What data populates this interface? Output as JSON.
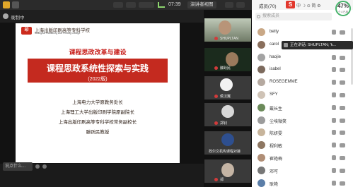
{
  "topbar": {
    "time": "07:39",
    "presenter_label": "演讲者视图"
  },
  "status": {
    "recording_text": "录制中"
  },
  "slide": {
    "org_name": "上海出版印刷高等专科学校",
    "org_sub": "Shanghai Publishing and Printing College",
    "topic": "课程思政改革与建设",
    "title": "课程思政系统性探索与实践",
    "year": "(2022版)",
    "lines": [
      "上海电力大学原教务处长",
      "上海理工大学出版印刷学院原副院长",
      "上海出版印刷高等专科学校常务副校长",
      "滕跃民教授"
    ]
  },
  "bottom": {
    "comment_placeholder": "说点什么..."
  },
  "video_tiles": [
    {
      "name": "SHUPLTAN"
    },
    {
      "name": "滕跃民"
    },
    {
      "name": "侯汉翼"
    },
    {
      "name": "郑钊"
    },
    {
      "name": "政尔文机构课程对接"
    },
    {
      "name": "郑"
    }
  ],
  "panel": {
    "title": "成员(70)",
    "sohu_text": "中 ☽ ⊙ 简 ⚙",
    "gauge_value": "47",
    "gauge_unit": "%",
    "gauge_sub": "个人已用",
    "search_placeholder": "搜索成员",
    "participants": [
      {
        "name": "betty",
        "color": "#c9a886"
      },
      {
        "name": "carol",
        "color": "#8a6f5c"
      },
      {
        "name": "haojie",
        "color": "#a3a3a3"
      },
      {
        "name": "isabel",
        "color": "#7c6a5d"
      },
      {
        "name": "ROSEGEMME",
        "color": "#b5a9a0"
      },
      {
        "name": "SFY",
        "color": "#cfc3b6"
      },
      {
        "name": "戴长生",
        "color": "#6b8a5a"
      },
      {
        "name": "尘埃微笑",
        "color": "#9c9c9c"
      },
      {
        "name": "陈妍雯",
        "color": "#c7b49b"
      },
      {
        "name": "程利敏",
        "color": "#8e7762"
      },
      {
        "name": "崔艳梅",
        "color": "#b08e76"
      },
      {
        "name": "邓可",
        "color": "#777777"
      },
      {
        "name": "耿艳",
        "color": "#5b7ea8"
      }
    ]
  },
  "toast": {
    "text": "正在讲话: SHUPLTAN; 'k..."
  }
}
